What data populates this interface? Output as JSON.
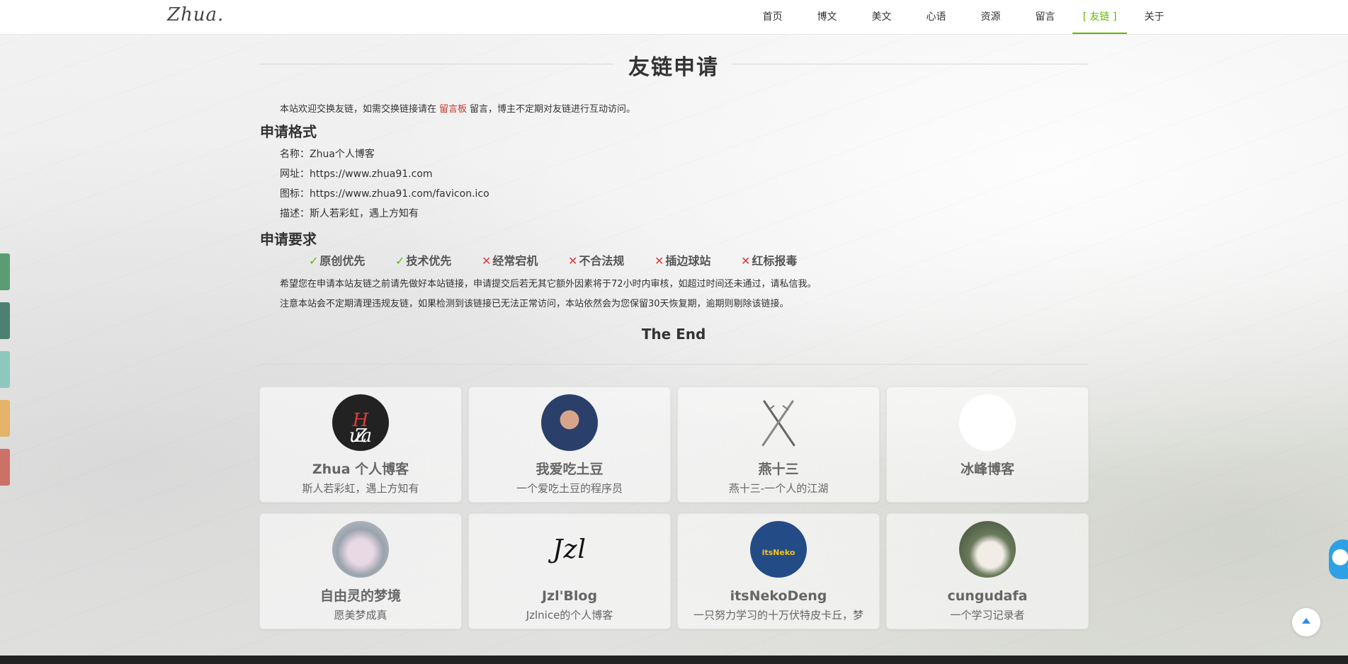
{
  "header": {
    "logo": "Zhua.",
    "nav": [
      "首页",
      "博文",
      "美文",
      "心语",
      "资源",
      "留言",
      "[ 友链 ]",
      "关于"
    ],
    "active_index": 6,
    "accent": "#5fb800"
  },
  "side_tabs": [
    "#5a9d72",
    "#4d7f73",
    "#8cc8bd",
    "#e4b46a",
    "#cc7168"
  ],
  "main": {
    "title": "友链申请",
    "intro_before": "本站欢迎交换友链，如需交换链接请在",
    "intro_link": "留言板",
    "intro_after": "留言，博主不定期对友链进行互动访问。",
    "format_title": "申请格式",
    "format": [
      {
        "key": "名称：",
        "value": "Zhua个人博客"
      },
      {
        "key": "网址：",
        "value": "https://www.zhua91.com"
      },
      {
        "key": "图标：",
        "value": "https://www.zhua91.com/favicon.ico"
      },
      {
        "key": "描述：",
        "value": "斯人若彩虹，遇上方知有"
      }
    ],
    "req_title": "申请要求",
    "requirements": [
      {
        "mark": "✓",
        "ok": true,
        "label": "原创优先"
      },
      {
        "mark": "✓",
        "ok": true,
        "label": "技术优先"
      },
      {
        "mark": "✕",
        "ok": false,
        "label": "经常宕机"
      },
      {
        "mark": "✕",
        "ok": false,
        "label": "不合法规"
      },
      {
        "mark": "✕",
        "ok": false,
        "label": "插边球站"
      },
      {
        "mark": "✕",
        "ok": false,
        "label": "红标报毒"
      }
    ],
    "note1": "希望您在申请本站友链之前请先做好本站链接，申请提交后若无其它额外因素将于72小时内审核，如超过时间还未通过，请私信我。",
    "note2": "注意本站会不定期清理违规友链，如果检测到该链接已无法正常访问，本站依然会为您保留30天恢复期，逾期则剔除该链接。",
    "end": "The End"
  },
  "links": [
    {
      "name": "Zhua 个人博客",
      "desc": "斯人若彩虹，遇上方知有",
      "avatar": "zhua-logo"
    },
    {
      "name": "我爱吃土豆",
      "desc": "一个爱吃土豆的程序员",
      "avatar": "potato-avatar"
    },
    {
      "name": "燕十三",
      "desc": "燕十三-一个人的江湖",
      "avatar": "crossed-swords"
    },
    {
      "name": "冰峰博客",
      "desc": "",
      "avatar": "blank-avatar"
    },
    {
      "name": "自由灵的梦境",
      "desc": "愿美梦成真",
      "avatar": "anime-avatar"
    },
    {
      "name": "Jzl'Blog",
      "desc": "Jzlnice的个人博客",
      "avatar": "jzl-signature"
    },
    {
      "name": "itsNekoDeng",
      "desc": "一只努力学习的十万伏特皮卡丘，梦",
      "avatar": "itsneko-logo"
    },
    {
      "name": "cungudafa",
      "desc": "一个学习记录者",
      "avatar": "photo-avatar"
    }
  ],
  "avatar_text": {
    "zhua_a": "Z",
    "zhua_b": "H",
    "zhua_c": "ua",
    "jzl": "Jzl",
    "neko": "itsNeko"
  }
}
